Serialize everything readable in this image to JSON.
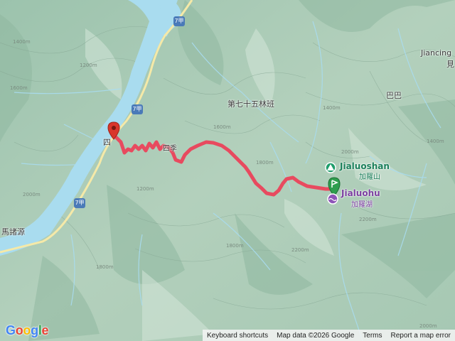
{
  "map": {
    "logo": "Google",
    "attribution": {
      "keyboard_shortcuts": "Keyboard shortcuts",
      "map_data": "Map data ©2026 Google",
      "terms": "Terms",
      "report": "Report a map error"
    },
    "labels": {
      "masiyuan": "馬諸源",
      "forest_area": "第七十五林班",
      "baba": "巴巴",
      "jiancing_partial": "Jiancing",
      "jian_partial": "見",
      "si": "四",
      "siji": "四季",
      "jialuoshan_en": "Jialuoshan",
      "jialuoshan_zh": "加羅山",
      "jialuohu_en": "Jialuohu",
      "jialuohu_zh": "加羅湖"
    },
    "road_shields": [
      "7甲",
      "7甲",
      "7甲"
    ],
    "elevations": [
      "1200m",
      "1400m",
      "1600m",
      "1800m",
      "1800m",
      "2000m",
      "2000m",
      "2200m",
      "2200m",
      "1400m",
      "1600m",
      "2000m",
      "1200m",
      "1400m",
      "1800m"
    ],
    "colors": {
      "route": "#e84a5f",
      "river": "#a9dcef",
      "road": "#f5e9a8",
      "start_pin": "#d9362b",
      "end_pin": "#2e9e4e",
      "lake_pin": "#8e55b8",
      "peak_pin": "#1f9d6b"
    },
    "icons": {
      "start": "red-location-pin-icon",
      "end": "green-flag-pin-icon",
      "peak": "mountain-peak-icon",
      "lake": "lake-icon"
    }
  }
}
